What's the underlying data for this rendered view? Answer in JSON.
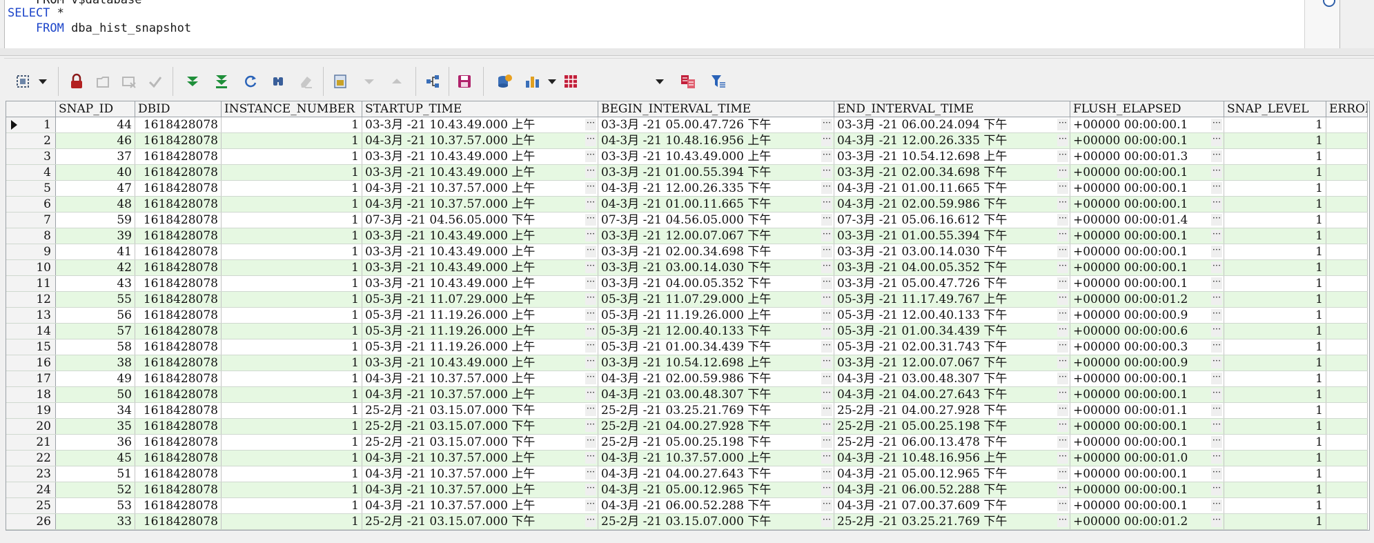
{
  "editor": {
    "line0": "    FROM v$database",
    "line1_kw": "SELECT",
    "line1_rest": " *",
    "line2_kw": "    FROM",
    "line2_rest": " dba_hist_snapshot"
  },
  "toolbar": {
    "icons": [
      "grid-select-icon",
      "lock-icon",
      "new-record-icon",
      "cancel-edit-icon",
      "commit-check-icon",
      "fetch-next-icon",
      "fetch-all-icon",
      "refresh-icon",
      "find-icon",
      "clear-icon",
      "single-record-icon",
      "next-record-icon",
      "previous-record-icon",
      "query-builder-icon",
      "save-icon",
      "export-database-icon",
      "chart-icon",
      "grid-view-icon",
      "compare-icon",
      "filter-icon"
    ]
  },
  "grid": {
    "columns": [
      "SNAP_ID",
      "DBID",
      "INSTANCE_NUMBER",
      "STARTUP_TIME",
      "BEGIN_INTERVAL_TIME",
      "END_INTERVAL_TIME",
      "FLUSH_ELAPSED",
      "SNAP_LEVEL",
      "ERROR"
    ],
    "ellipsis": "···",
    "rows": [
      [
        "1",
        "44",
        "1618428078",
        "1",
        "03-3月 -21 10.43.49.000 上午",
        "03-3月 -21 05.00.47.726 下午",
        "03-3月 -21 06.00.24.094 下午",
        "+00000 00:00:00.1",
        "1"
      ],
      [
        "2",
        "46",
        "1618428078",
        "1",
        "04-3月 -21 10.37.57.000 上午",
        "04-3月 -21 10.48.16.956 上午",
        "04-3月 -21 12.00.26.335 下午",
        "+00000 00:00:00.1",
        "1"
      ],
      [
        "3",
        "37",
        "1618428078",
        "1",
        "03-3月 -21 10.43.49.000 上午",
        "03-3月 -21 10.43.49.000 上午",
        "03-3月 -21 10.54.12.698 上午",
        "+00000 00:00:01.3",
        "1"
      ],
      [
        "4",
        "40",
        "1618428078",
        "1",
        "03-3月 -21 10.43.49.000 上午",
        "03-3月 -21 01.00.55.394 下午",
        "03-3月 -21 02.00.34.698 下午",
        "+00000 00:00:00.1",
        "1"
      ],
      [
        "5",
        "47",
        "1618428078",
        "1",
        "04-3月 -21 10.37.57.000 上午",
        "04-3月 -21 12.00.26.335 下午",
        "04-3月 -21 01.00.11.665 下午",
        "+00000 00:00:00.1",
        "1"
      ],
      [
        "6",
        "48",
        "1618428078",
        "1",
        "04-3月 -21 10.37.57.000 上午",
        "04-3月 -21 01.00.11.665 下午",
        "04-3月 -21 02.00.59.986 下午",
        "+00000 00:00:00.1",
        "1"
      ],
      [
        "7",
        "59",
        "1618428078",
        "1",
        "07-3月 -21 04.56.05.000 下午",
        "07-3月 -21 04.56.05.000 下午",
        "07-3月 -21 05.06.16.612 下午",
        "+00000 00:00:01.4",
        "1"
      ],
      [
        "8",
        "39",
        "1618428078",
        "1",
        "03-3月 -21 10.43.49.000 上午",
        "03-3月 -21 12.00.07.067 下午",
        "03-3月 -21 01.00.55.394 下午",
        "+00000 00:00:00.1",
        "1"
      ],
      [
        "9",
        "41",
        "1618428078",
        "1",
        "03-3月 -21 10.43.49.000 上午",
        "03-3月 -21 02.00.34.698 下午",
        "03-3月 -21 03.00.14.030 下午",
        "+00000 00:00:00.1",
        "1"
      ],
      [
        "10",
        "42",
        "1618428078",
        "1",
        "03-3月 -21 10.43.49.000 上午",
        "03-3月 -21 03.00.14.030 下午",
        "03-3月 -21 04.00.05.352 下午",
        "+00000 00:00:00.1",
        "1"
      ],
      [
        "11",
        "43",
        "1618428078",
        "1",
        "03-3月 -21 10.43.49.000 上午",
        "03-3月 -21 04.00.05.352 下午",
        "03-3月 -21 05.00.47.726 下午",
        "+00000 00:00:00.1",
        "1"
      ],
      [
        "12",
        "55",
        "1618428078",
        "1",
        "05-3月 -21 11.07.29.000 上午",
        "05-3月 -21 11.07.29.000 上午",
        "05-3月 -21 11.17.49.767 上午",
        "+00000 00:00:01.2",
        "1"
      ],
      [
        "13",
        "56",
        "1618428078",
        "1",
        "05-3月 -21 11.19.26.000 上午",
        "05-3月 -21 11.19.26.000 上午",
        "05-3月 -21 12.00.40.133 下午",
        "+00000 00:00:00.9",
        "1"
      ],
      [
        "14",
        "57",
        "1618428078",
        "1",
        "05-3月 -21 11.19.26.000 上午",
        "05-3月 -21 12.00.40.133 下午",
        "05-3月 -21 01.00.34.439 下午",
        "+00000 00:00:00.6",
        "1"
      ],
      [
        "15",
        "58",
        "1618428078",
        "1",
        "05-3月 -21 11.19.26.000 上午",
        "05-3月 -21 01.00.34.439 下午",
        "05-3月 -21 02.00.31.743 下午",
        "+00000 00:00:00.3",
        "1"
      ],
      [
        "16",
        "38",
        "1618428078",
        "1",
        "03-3月 -21 10.43.49.000 上午",
        "03-3月 -21 10.54.12.698 上午",
        "03-3月 -21 12.00.07.067 下午",
        "+00000 00:00:00.9",
        "1"
      ],
      [
        "17",
        "49",
        "1618428078",
        "1",
        "04-3月 -21 10.37.57.000 上午",
        "04-3月 -21 02.00.59.986 下午",
        "04-3月 -21 03.00.48.307 下午",
        "+00000 00:00:00.1",
        "1"
      ],
      [
        "18",
        "50",
        "1618428078",
        "1",
        "04-3月 -21 10.37.57.000 上午",
        "04-3月 -21 03.00.48.307 下午",
        "04-3月 -21 04.00.27.643 下午",
        "+00000 00:00:00.1",
        "1"
      ],
      [
        "19",
        "34",
        "1618428078",
        "1",
        "25-2月 -21 03.15.07.000 下午",
        "25-2月 -21 03.25.21.769 下午",
        "25-2月 -21 04.00.27.928 下午",
        "+00000 00:00:01.1",
        "1"
      ],
      [
        "20",
        "35",
        "1618428078",
        "1",
        "25-2月 -21 03.15.07.000 下午",
        "25-2月 -21 04.00.27.928 下午",
        "25-2月 -21 05.00.25.198 下午",
        "+00000 00:00:00.1",
        "1"
      ],
      [
        "21",
        "36",
        "1618428078",
        "1",
        "25-2月 -21 03.15.07.000 下午",
        "25-2月 -21 05.00.25.198 下午",
        "25-2月 -21 06.00.13.478 下午",
        "+00000 00:00:00.1",
        "1"
      ],
      [
        "22",
        "45",
        "1618428078",
        "1",
        "04-3月 -21 10.37.57.000 上午",
        "04-3月 -21 10.37.57.000 上午",
        "04-3月 -21 10.48.16.956 上午",
        "+00000 00:00:01.0",
        "1"
      ],
      [
        "23",
        "51",
        "1618428078",
        "1",
        "04-3月 -21 10.37.57.000 上午",
        "04-3月 -21 04.00.27.643 下午",
        "04-3月 -21 05.00.12.965 下午",
        "+00000 00:00:00.1",
        "1"
      ],
      [
        "24",
        "52",
        "1618428078",
        "1",
        "04-3月 -21 10.37.57.000 上午",
        "04-3月 -21 05.00.12.965 下午",
        "04-3月 -21 06.00.52.288 下午",
        "+00000 00:00:00.1",
        "1"
      ],
      [
        "25",
        "53",
        "1618428078",
        "1",
        "04-3月 -21 10.37.57.000 上午",
        "04-3月 -21 06.00.52.288 下午",
        "04-3月 -21 07.00.37.609 下午",
        "+00000 00:00:00.1",
        "1"
      ],
      [
        "26",
        "33",
        "1618428078",
        "1",
        "25-2月 -21 03.15.07.000 下午",
        "25-2月 -21 03.15.07.000 下午",
        "25-2月 -21 03.25.21.769 下午",
        "+00000 00:00:01.2",
        "1"
      ]
    ]
  },
  "colors": {
    "keyword": "#1b44c9",
    "row_alt": "#e6f8e2",
    "grid_border": "#9aa0a6"
  }
}
